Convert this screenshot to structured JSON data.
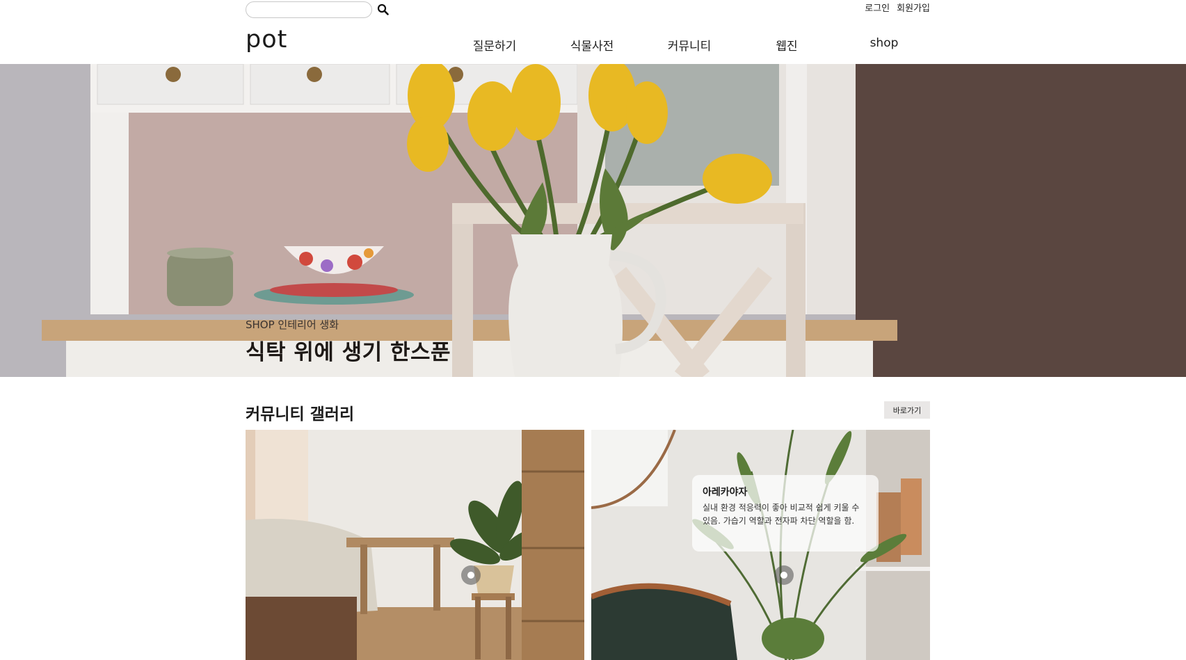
{
  "search": {
    "placeholder": "",
    "icon": "search-icon"
  },
  "auth": {
    "login": "로그인",
    "signup": "회원가입"
  },
  "header": {
    "logo": "pot"
  },
  "nav": {
    "items": [
      {
        "label": "질문하기"
      },
      {
        "label": "식물사전"
      },
      {
        "label": "커뮤니티"
      },
      {
        "label": "웹진"
      },
      {
        "label": "shop"
      }
    ]
  },
  "hero": {
    "subtitle": "SHOP 인테리어 생화",
    "title": "식탁 위에 생기 한스푼"
  },
  "gallery": {
    "title": "커뮤니티 갤러리",
    "shortcut": "바로가기",
    "tooltip": {
      "name": "아레카야자",
      "description": "실내 환경 적응력이 좋아 비교적 쉽게 키울 수 있음. 가습기 역할과 전자파 차단 역할을 함."
    }
  },
  "colors": {
    "tulip": "#e8b923",
    "wall_brown": "#5a4640",
    "hutch_white": "#f3f1ef",
    "wood": "#c8a47a"
  }
}
